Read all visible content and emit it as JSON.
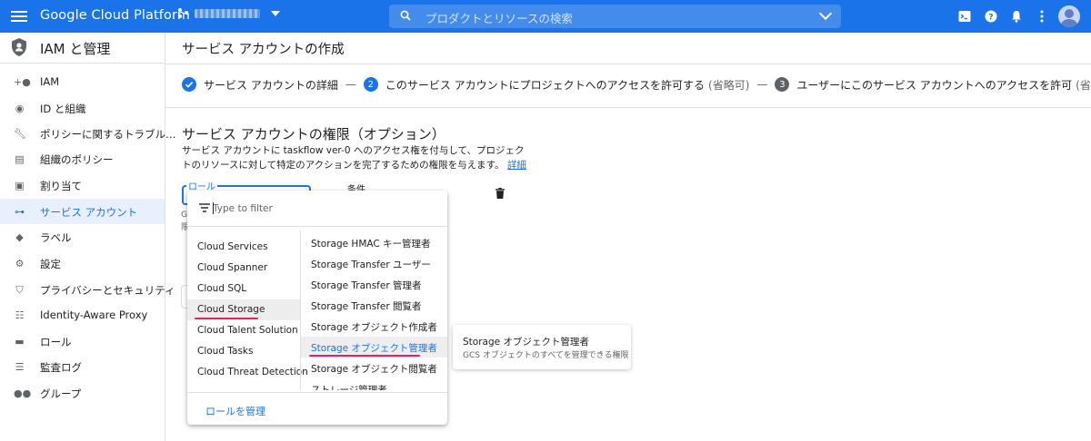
{
  "topbar": {
    "brand": "Google Cloud Platform",
    "search_placeholder": "プロダクトとリソースの検索",
    "icons": [
      "terminal-icon",
      "help-icon",
      "notifications-icon",
      "more-vert-icon"
    ]
  },
  "sidebar": {
    "title": "IAM と管理",
    "items": [
      {
        "label": "IAM",
        "icon": "person-add-icon"
      },
      {
        "label": "ID と組織",
        "icon": "account-circle-icon"
      },
      {
        "label": "ポリシーに関するトラブル…",
        "icon": "wrench-icon"
      },
      {
        "label": "組織のポリシー",
        "icon": "document-icon"
      },
      {
        "label": "割り当て",
        "icon": "quota-icon"
      },
      {
        "label": "サービス アカウント",
        "icon": "service-account-icon"
      },
      {
        "label": "ラベル",
        "icon": "label-icon"
      },
      {
        "label": "設定",
        "icon": "settings-icon"
      },
      {
        "label": "プライバシーとセキュリティ",
        "icon": "shield-icon"
      },
      {
        "label": "Identity-Aware Proxy",
        "icon": "proxy-icon"
      },
      {
        "label": "ロール",
        "icon": "hat-icon"
      },
      {
        "label": "監査ログ",
        "icon": "list-icon"
      },
      {
        "label": "グループ",
        "icon": "group-icon"
      }
    ]
  },
  "main": {
    "title": "サービス アカウントの作成",
    "steps": [
      {
        "text": "サービス アカウントの詳細",
        "optional": ""
      },
      {
        "num": "2",
        "text": "このサービス アカウントにプロジェクトへのアクセスを許可する",
        "optional": "(省略可)"
      },
      {
        "num": "3",
        "text": "ユーザーにこのサービス アカウントへのアクセスを許可",
        "optional": "(省略可)"
      }
    ],
    "step_separator": "—",
    "section_title": "サービス アカウントの権限（オプション）",
    "section_desc": "サービス アカウントに taskflow ver-0 へのアクセス権を付与して、プロジェクトのリソースに対して特定のアクションを完了するための権限を与えます。",
    "section_link": "詳細",
    "role_label": "ロール",
    "condition_label": "条件",
    "hint_line1": "GC",
    "hint_line2": "限"
  },
  "dropdown": {
    "filter_placeholder": "Type to filter",
    "left_options": [
      "Cloud Services",
      "Cloud Spanner",
      "Cloud SQL",
      "Cloud Storage",
      "Cloud Talent Solution",
      "Cloud Tasks",
      "Cloud Threat Detection"
    ],
    "right_options": [
      "Storage HMAC キー管理者",
      "Storage Transfer ユーザー",
      "Storage Transfer 管理者",
      "Storage Transfer 閲覧者",
      "Storage オブジェクト作成者",
      "Storage オブジェクト管理者",
      "Storage オブジェクト閲覧者",
      "ストレージ管理者"
    ],
    "selected_left": "Cloud Storage",
    "selected_right": "Storage オブジェクト管理者",
    "manage_roles": "ロールを管理"
  },
  "tooltip": {
    "title": "Storage オブジェクト管理者",
    "desc": "GCS オブジェクトのすべてを管理できる権限"
  },
  "colors": {
    "primary": "#1a73e8",
    "highlight_underline": "#e91e63"
  }
}
